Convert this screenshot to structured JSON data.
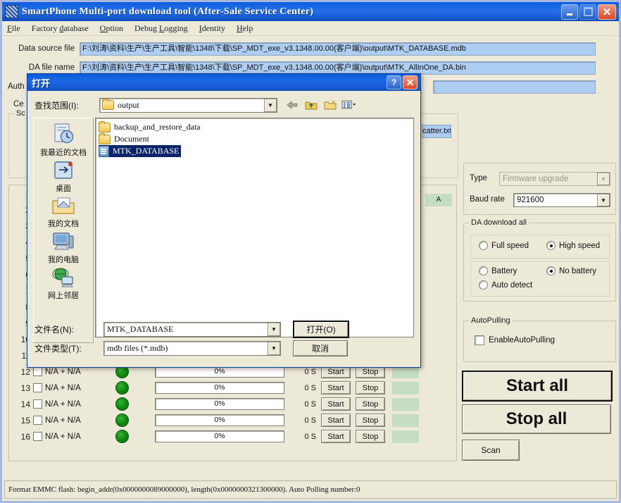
{
  "window": {
    "title": "SmartPhone Multi-port download tool (After-Sale Service Center)",
    "minimize": "minimize-icon",
    "maximize": "maximize-icon",
    "close": "✕"
  },
  "menubar": [
    {
      "label": "File",
      "accel": "F"
    },
    {
      "label": "Factory database",
      "accel": "d"
    },
    {
      "label": "Option",
      "accel": "O"
    },
    {
      "label": "Debug Logging",
      "accel": "L"
    },
    {
      "label": "Identity",
      "accel": "I"
    },
    {
      "label": "Help",
      "accel": "H"
    }
  ],
  "fields": {
    "data_source_label": "Data source file",
    "data_source_value": "F:\\刘涛\\资料\\生产\\生产工具\\智能\\1348\\下载\\SP_MDT_exe_v3.1348.00.00(客户端)\\output\\MTK_DATABASE.mdb",
    "da_file_label": "DA file name",
    "da_file_value": "F:\\刘涛\\资料\\生产\\生产工具\\智能\\1348\\下载\\SP_MDT_exe_v3.1348.00.00(客户端)\\output\\MTK_AllInOne_DA.bin",
    "auth_label": "Auth",
    "cert_label": "Ce",
    "scatter_group_label": "Sc",
    "scatter_value": "catter.txt"
  },
  "ports": {
    "status_header": "A",
    "rows": [
      {
        "num": "1",
        "name": "",
        "progress": "",
        "secs": "",
        "start": "",
        "stop": "",
        "hidden": true
      },
      {
        "num": "2",
        "name": "",
        "progress": "",
        "secs": "",
        "start": "",
        "stop": "",
        "hidden": true
      },
      {
        "num": "3",
        "name": "",
        "progress": "",
        "secs": "",
        "start": "",
        "stop": "",
        "hidden": true
      },
      {
        "num": "4",
        "name": "",
        "progress": "",
        "secs": "",
        "start": "",
        "stop": "",
        "hidden": true
      },
      {
        "num": "5",
        "name": "",
        "progress": "",
        "secs": "",
        "start": "",
        "stop": "",
        "hidden": true
      },
      {
        "num": "6",
        "name": "",
        "progress": "",
        "secs": "",
        "start": "",
        "stop": "",
        "hidden": true
      },
      {
        "num": "7",
        "name": "",
        "progress": "",
        "secs": "",
        "start": "",
        "stop": "",
        "hidden": true
      },
      {
        "num": "8",
        "name": "",
        "progress": "",
        "secs": "",
        "start": "",
        "stop": "",
        "hidden": true
      },
      {
        "num": "9",
        "name": "",
        "progress": "",
        "secs": "",
        "start": "",
        "stop": "",
        "hidden": true
      },
      {
        "num": "10",
        "name": "",
        "progress": "",
        "secs": "",
        "start": "",
        "stop": "",
        "hidden": true
      },
      {
        "num": "11",
        "name": "",
        "progress": "",
        "secs": "",
        "start": "",
        "stop": "",
        "hidden": true
      },
      {
        "num": "12",
        "name": "N/A + N/A",
        "progress": "0%",
        "secs": "0 S",
        "start": "Start",
        "stop": "Stop",
        "hidden": false
      },
      {
        "num": "13",
        "name": "N/A + N/A",
        "progress": "0%",
        "secs": "0 S",
        "start": "Start",
        "stop": "Stop",
        "hidden": false
      },
      {
        "num": "14",
        "name": "N/A + N/A",
        "progress": "0%",
        "secs": "0 S",
        "start": "Start",
        "stop": "Stop",
        "hidden": false
      },
      {
        "num": "15",
        "name": "N/A + N/A",
        "progress": "0%",
        "secs": "0 S",
        "start": "Start",
        "stop": "Stop",
        "hidden": false
      },
      {
        "num": "16",
        "name": "N/A + N/A",
        "progress": "0%",
        "secs": "0 S",
        "start": "Start",
        "stop": "Stop",
        "hidden": false
      }
    ]
  },
  "settings": {
    "type_label": "Type",
    "type_value": "Firmware upgrade",
    "baud_label": "Baud rate",
    "baud_value": "921600",
    "da_group_label": "DA download all",
    "speed": [
      {
        "label": "Full speed",
        "selected": false
      },
      {
        "label": "High speed",
        "selected": true
      }
    ],
    "battery": [
      {
        "label": "Battery",
        "selected": false
      },
      {
        "label": "No battery",
        "selected": true
      },
      {
        "label": "Auto detect",
        "selected": false
      }
    ],
    "autopulling_group_label": "AutoPulling",
    "autopulling_checkbox": "EnableAutoPulling",
    "autopulling_checked": false,
    "start_all": "Start all",
    "stop_all": "Stop all",
    "scan": "Scan"
  },
  "dialog": {
    "title": "打开",
    "help_btn": "?",
    "close_btn": "✕",
    "lookin_label": "查找范围(I):",
    "lookin_value": "output",
    "toolbar": [
      "back-icon",
      "up-folder-icon",
      "new-folder-icon",
      "views-icon"
    ],
    "places": [
      {
        "label": "我最近的文档",
        "icon": "recent-documents-icon"
      },
      {
        "label": "桌面",
        "icon": "desktop-icon"
      },
      {
        "label": "我的文档",
        "icon": "my-documents-icon"
      },
      {
        "label": "我的电脑",
        "icon": "my-computer-icon"
      },
      {
        "label": "网上邻居",
        "icon": "network-places-icon"
      }
    ],
    "files": [
      {
        "name": "backup_and_restore_data",
        "type": "folder",
        "selected": false
      },
      {
        "name": "Document",
        "type": "folder",
        "selected": false
      },
      {
        "name": "MTK_DATABASE",
        "type": "mdb",
        "selected": true
      }
    ],
    "filename_label": "文件名(N):",
    "filename_value": "MTK_DATABASE",
    "filetype_label": "文件类型(T):",
    "filetype_value": "mdb files (*.mdb)",
    "open_btn": "打开(O)",
    "cancel_btn": "取消"
  },
  "statusbar": {
    "text": "Format EMMC flash:  begin_addr(0x0000000089000000), length(0x0000000321300000). Auto Polling number:0"
  }
}
